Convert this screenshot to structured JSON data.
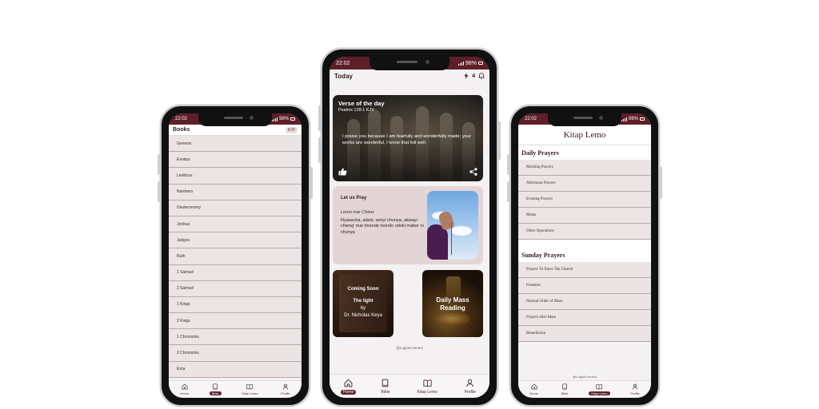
{
  "left_phone": {
    "status": {
      "time": "22:02",
      "battery": "98%"
    },
    "header": {
      "title": "Books",
      "version": "KJV"
    },
    "books": [
      "Genesis",
      "Exodus",
      "Leviticus",
      "Numbers",
      "Deuteronomy",
      "Joshua",
      "Judges",
      "Ruth",
      "1 Samuel",
      "2 Samuel",
      "1 Kings",
      "2 Kings",
      "1 Chronicles",
      "2 Chronicles",
      "Ezra"
    ],
    "nav": [
      "Home",
      "Bible",
      "Kitap Lemo",
      "Profile"
    ],
    "active_nav": "Bible"
  },
  "center_phone": {
    "status": {
      "time": "22:02",
      "battery": "98%"
    },
    "header": {
      "title": "Today",
      "streak": "4"
    },
    "verse_card": {
      "title": "Verse of the day",
      "reference": "Psalms 139:1 KJV",
      "text": "I praise you because I am fearfully and wonderfully made; your works are wonderful, I know that full well."
    },
    "pray_card": {
      "title": "Let us Pray",
      "subtitle": "Lemo mar Chiew",
      "text": "Nyasacha, alami, amiyi chunya, akwayi chieng' mar tinende mondo odoki maber ni chunya"
    },
    "coming_soon": {
      "label": "Coming Soon",
      "book_title": "The light",
      "by": "by",
      "author": "Dr. Nicholas Keya"
    },
    "mass_card": {
      "line1": "Daily Mass",
      "line2": "Reading"
    },
    "footer": "@LogosConnect",
    "nav": [
      "Home",
      "Bible",
      "Kitap Lemo",
      "Profile"
    ],
    "active_nav": "Home"
  },
  "right_phone": {
    "status": {
      "time": "22:02",
      "battery": "98%"
    },
    "title": "Kitap Lemo",
    "daily_title": "Daily Prayers",
    "daily": [
      "Morning Prayers",
      "Afternoon Prayers",
      "Evening Prayers",
      "Meals",
      "Other Operations"
    ],
    "sunday_title": "Sunday Prayers",
    "sunday": [
      "Prayers To Enter The Church",
      "Freedom",
      "Normal Order of Mass",
      "Prayers after Mass",
      "Benediction"
    ],
    "footer": "@LogosConnect",
    "nav": [
      "Home",
      "Bible",
      "Kitap Lemo",
      "Profile"
    ],
    "active_nav": "Kitap Lemo"
  },
  "colors": {
    "brand": "#5e1f28",
    "list_bg": "#ebe4e4",
    "pray_card_bg": "#e3d5d5"
  }
}
